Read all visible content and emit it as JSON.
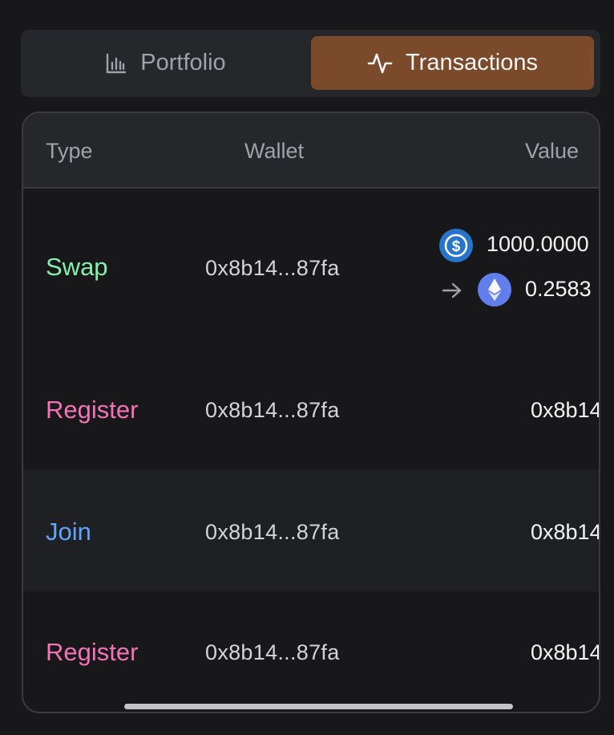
{
  "tabs": {
    "portfolio": "Portfolio",
    "transactions": "Transactions"
  },
  "table": {
    "headers": {
      "type": "Type",
      "wallet": "Wallet",
      "value": "Value"
    },
    "rows": [
      {
        "type": "Swap",
        "wallet": "0x8b14...87fa",
        "from_amount": "1000.0000",
        "to_amount": "0.2583",
        "from_icon": "usdc-icon",
        "to_icon": "ethereum-icon",
        "arrow_icon": "arrow-right-icon"
      },
      {
        "type": "Register",
        "wallet": "0x8b14...87fa",
        "value": "0x8b14"
      },
      {
        "type": "Join",
        "wallet": "0x8b14...87fa",
        "value": "0x8b14"
      },
      {
        "type": "Register",
        "wallet": "0x8b14...87fa",
        "value": "0x8b14"
      }
    ]
  },
  "colors": {
    "active_tab": "#7a4a2b",
    "swap": "#86efac",
    "register": "#f472b6",
    "join": "#60a5fa"
  }
}
